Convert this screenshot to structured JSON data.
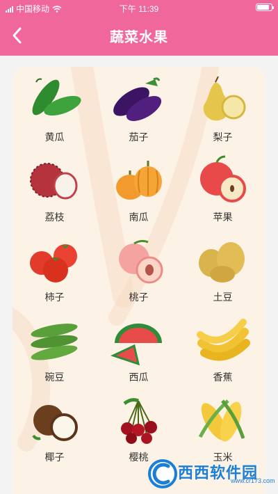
{
  "status_bar": {
    "carrier": "中国移动",
    "time": "下午 11:39",
    "battery_level": 0.85
  },
  "header": {
    "title": "蔬菜水果"
  },
  "items": [
    {
      "label": "黄瓜",
      "icon": "cucumber-icon"
    },
    {
      "label": "茄子",
      "icon": "eggplant-icon"
    },
    {
      "label": "梨子",
      "icon": "pear-icon"
    },
    {
      "label": "荔枝",
      "icon": "lychee-icon"
    },
    {
      "label": "南瓜",
      "icon": "pumpkin-icon"
    },
    {
      "label": "苹果",
      "icon": "apple-icon"
    },
    {
      "label": "柿子",
      "icon": "tomato-icon"
    },
    {
      "label": "桃子",
      "icon": "peach-icon"
    },
    {
      "label": "土豆",
      "icon": "potato-icon"
    },
    {
      "label": "碗豆",
      "icon": "pea-icon"
    },
    {
      "label": "西瓜",
      "icon": "watermelon-icon"
    },
    {
      "label": "香蕉",
      "icon": "banana-icon"
    },
    {
      "label": "椰子",
      "icon": "coconut-icon"
    },
    {
      "label": "樱桃",
      "icon": "cherry-icon"
    },
    {
      "label": "玉米",
      "icon": "corn-icon"
    }
  ],
  "watermark": {
    "brand": "西西软件园",
    "url": "www.cr173.com"
  },
  "colors": {
    "header": "#f0679b",
    "card": "#fdf2e6",
    "label": "#333333"
  }
}
